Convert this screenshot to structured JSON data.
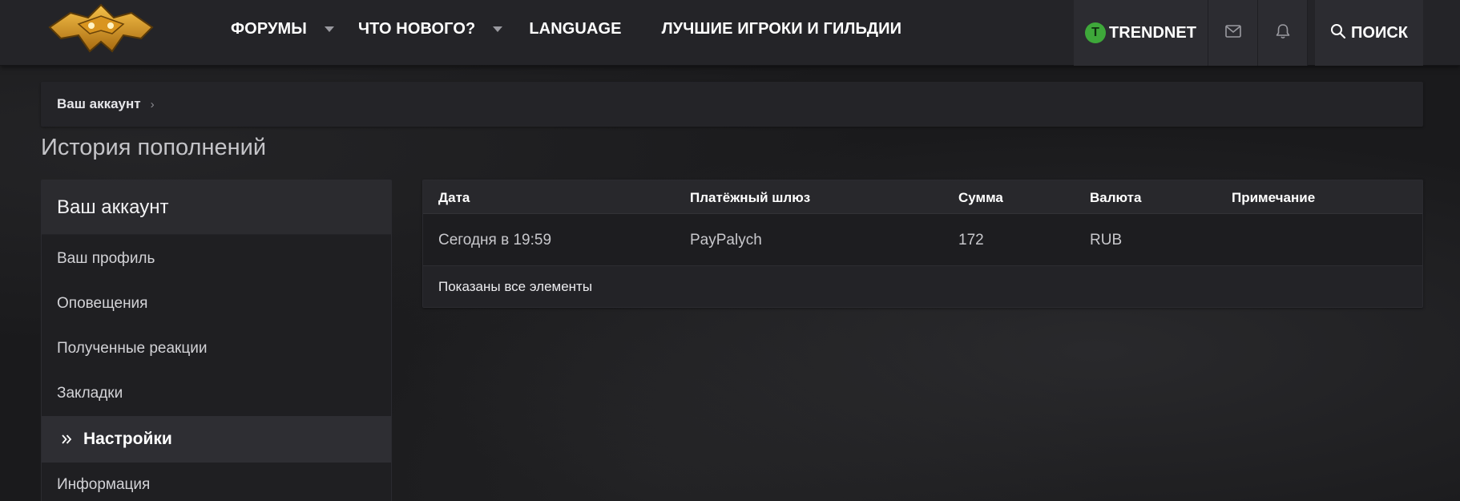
{
  "header": {
    "nav": [
      {
        "label": "ФОРУМЫ",
        "has_dropdown": true
      },
      {
        "label": "ЧТО НОВОГО?",
        "has_dropdown": true
      },
      {
        "label": "LANGUAGE",
        "has_dropdown": false
      },
      {
        "label": "ЛУЧШИЕ ИГРОКИ И ГИЛЬДИИ",
        "has_dropdown": false
      }
    ],
    "user": {
      "avatar_letter": "T",
      "name": "TRENDNET",
      "avatar_color": "#3ea83a"
    },
    "icons": {
      "mail": "mail-icon",
      "notifications": "bell-icon",
      "search": "search-icon"
    },
    "search_label": "ПОИСК"
  },
  "breadcrumb": {
    "items": [
      "Ваш аккаунт"
    ]
  },
  "page_title": "История пополнений",
  "sidebar": {
    "title": "Ваш аккаунт",
    "items": [
      {
        "label": "Ваш профиль"
      },
      {
        "label": "Оповещения"
      },
      {
        "label": "Полученные реакции"
      },
      {
        "label": "Закладки"
      },
      {
        "label": "Настройки",
        "active": true
      },
      {
        "label": "Информация"
      }
    ]
  },
  "table": {
    "columns": [
      "Дата",
      "Платёжный шлюз",
      "Сумма",
      "Валюта",
      "Примечание"
    ],
    "rows": [
      {
        "date": "Сегодня в 19:59",
        "gateway": "PayPalych",
        "amount": "172",
        "currency": "RUB",
        "note": ""
      }
    ],
    "footer": "Показаны все элементы"
  }
}
